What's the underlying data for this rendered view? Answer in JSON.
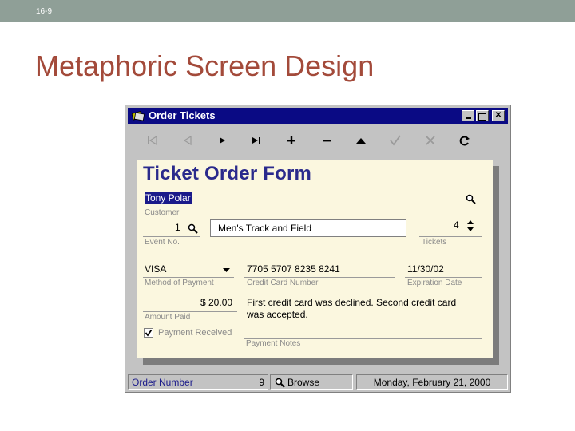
{
  "slide": {
    "number": "16-9",
    "title": "Metaphoric Screen Design"
  },
  "window": {
    "title": "Order Tickets",
    "controls": [
      "minimize",
      "maximize",
      "close"
    ]
  },
  "toolbar": {
    "buttons": [
      "first-record",
      "previous-record",
      "next-record",
      "last-record",
      "add",
      "delete",
      "up",
      "confirm",
      "cancel",
      "refresh"
    ]
  },
  "form": {
    "title": "Ticket Order Form",
    "customer": {
      "value": "Tony Polar",
      "label": "Customer"
    },
    "event_no": {
      "value": "1",
      "label": "Event No."
    },
    "event_name": {
      "value": "Men's Track and Field"
    },
    "tickets": {
      "value": "4",
      "label": "Tickets"
    },
    "method_of_payment": {
      "value": "VISA",
      "label": "Method of Payment"
    },
    "credit_card_number": {
      "value": "7705 5707 8235 8241",
      "label": "Credit Card Number"
    },
    "expiration_date": {
      "value": "11/30/02",
      "label": "Expiration Date"
    },
    "amount_paid": {
      "value": "$ 20.00",
      "label": "Amount Paid"
    },
    "payment_received": {
      "label": "Payment Received",
      "checked": true
    },
    "payment_notes": {
      "value": "First credit card was declined. Second credit card was accepted.",
      "label": "Payment Notes"
    }
  },
  "statusbar": {
    "order_label": "Order Number",
    "order_value": "9",
    "browse_label": "Browse",
    "date": "Monday, February 21, 2000"
  },
  "colors": {
    "titlebar": "#0a0a84",
    "form_title": "#2a2a8c",
    "slide_title": "#a34a3a",
    "status_text": "#1a1a8a"
  }
}
